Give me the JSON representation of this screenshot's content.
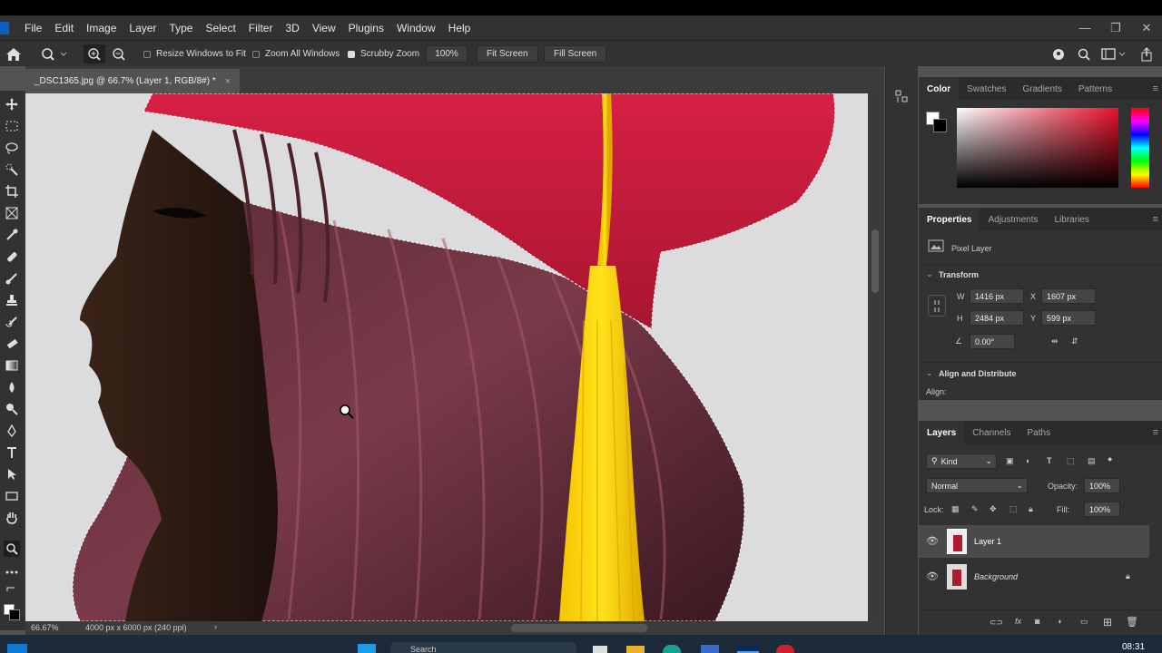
{
  "menu": {
    "items": [
      "File",
      "Edit",
      "Image",
      "Layer",
      "Type",
      "Select",
      "Filter",
      "3D",
      "View",
      "Plugins",
      "Window",
      "Help"
    ],
    "window_controls": [
      "—",
      "❐",
      "✕"
    ]
  },
  "options_bar": {
    "resize_windows": "Resize Windows to Fit",
    "zoom_all_windows": "Zoom All Windows",
    "scrubby_zoom": "Scrubby Zoom",
    "zoom_percent": "100%",
    "fit_screen": "Fit Screen",
    "fill_screen": "Fill Screen",
    "resize_checked": false,
    "zoom_all_checked": false,
    "scrubby_checked": true
  },
  "document": {
    "tab_title": "_DSC1365.jpg @ 66.7% (Layer 1, RGB/8#) *",
    "close": "×"
  },
  "status": {
    "zoom": "66.67%",
    "doc_info": "4000 px x 6000 px (240 ppi)",
    "arrow": "›"
  },
  "color_panel": {
    "tabs": [
      "Color",
      "Swatches",
      "Gradients",
      "Patterns"
    ],
    "active_tab": "Color",
    "hue_color": "#e8102a"
  },
  "properties_panel": {
    "tabs": [
      "Properties",
      "Adjustments",
      "Libraries"
    ],
    "active_tab": "Properties",
    "layer_type": "Pixel Layer",
    "transform_title": "Transform",
    "w_label": "W",
    "w_value": "1416 px",
    "h_label": "H",
    "h_value": "2484 px",
    "x_label": "X",
    "x_value": "1607 px",
    "y_label": "Y",
    "y_value": "599 px",
    "angle_value": "0.00°",
    "align_title": "Align and Distribute",
    "align_label": "Align:"
  },
  "layers_panel": {
    "tabs": [
      "Layers",
      "Channels",
      "Paths"
    ],
    "active_tab": "Layers",
    "filter_kind": "Kind",
    "blend_mode": "Normal",
    "opacity_label": "Opacity:",
    "opacity_value": "100%",
    "lock_label": "Lock:",
    "fill_label": "Fill:",
    "fill_value": "100%",
    "layers": [
      {
        "name": "Layer 1",
        "selected": true,
        "locked": false
      },
      {
        "name": "Background",
        "selected": false,
        "locked": true
      }
    ]
  },
  "taskbar": {
    "search_label": "Search",
    "time": "08:31"
  }
}
